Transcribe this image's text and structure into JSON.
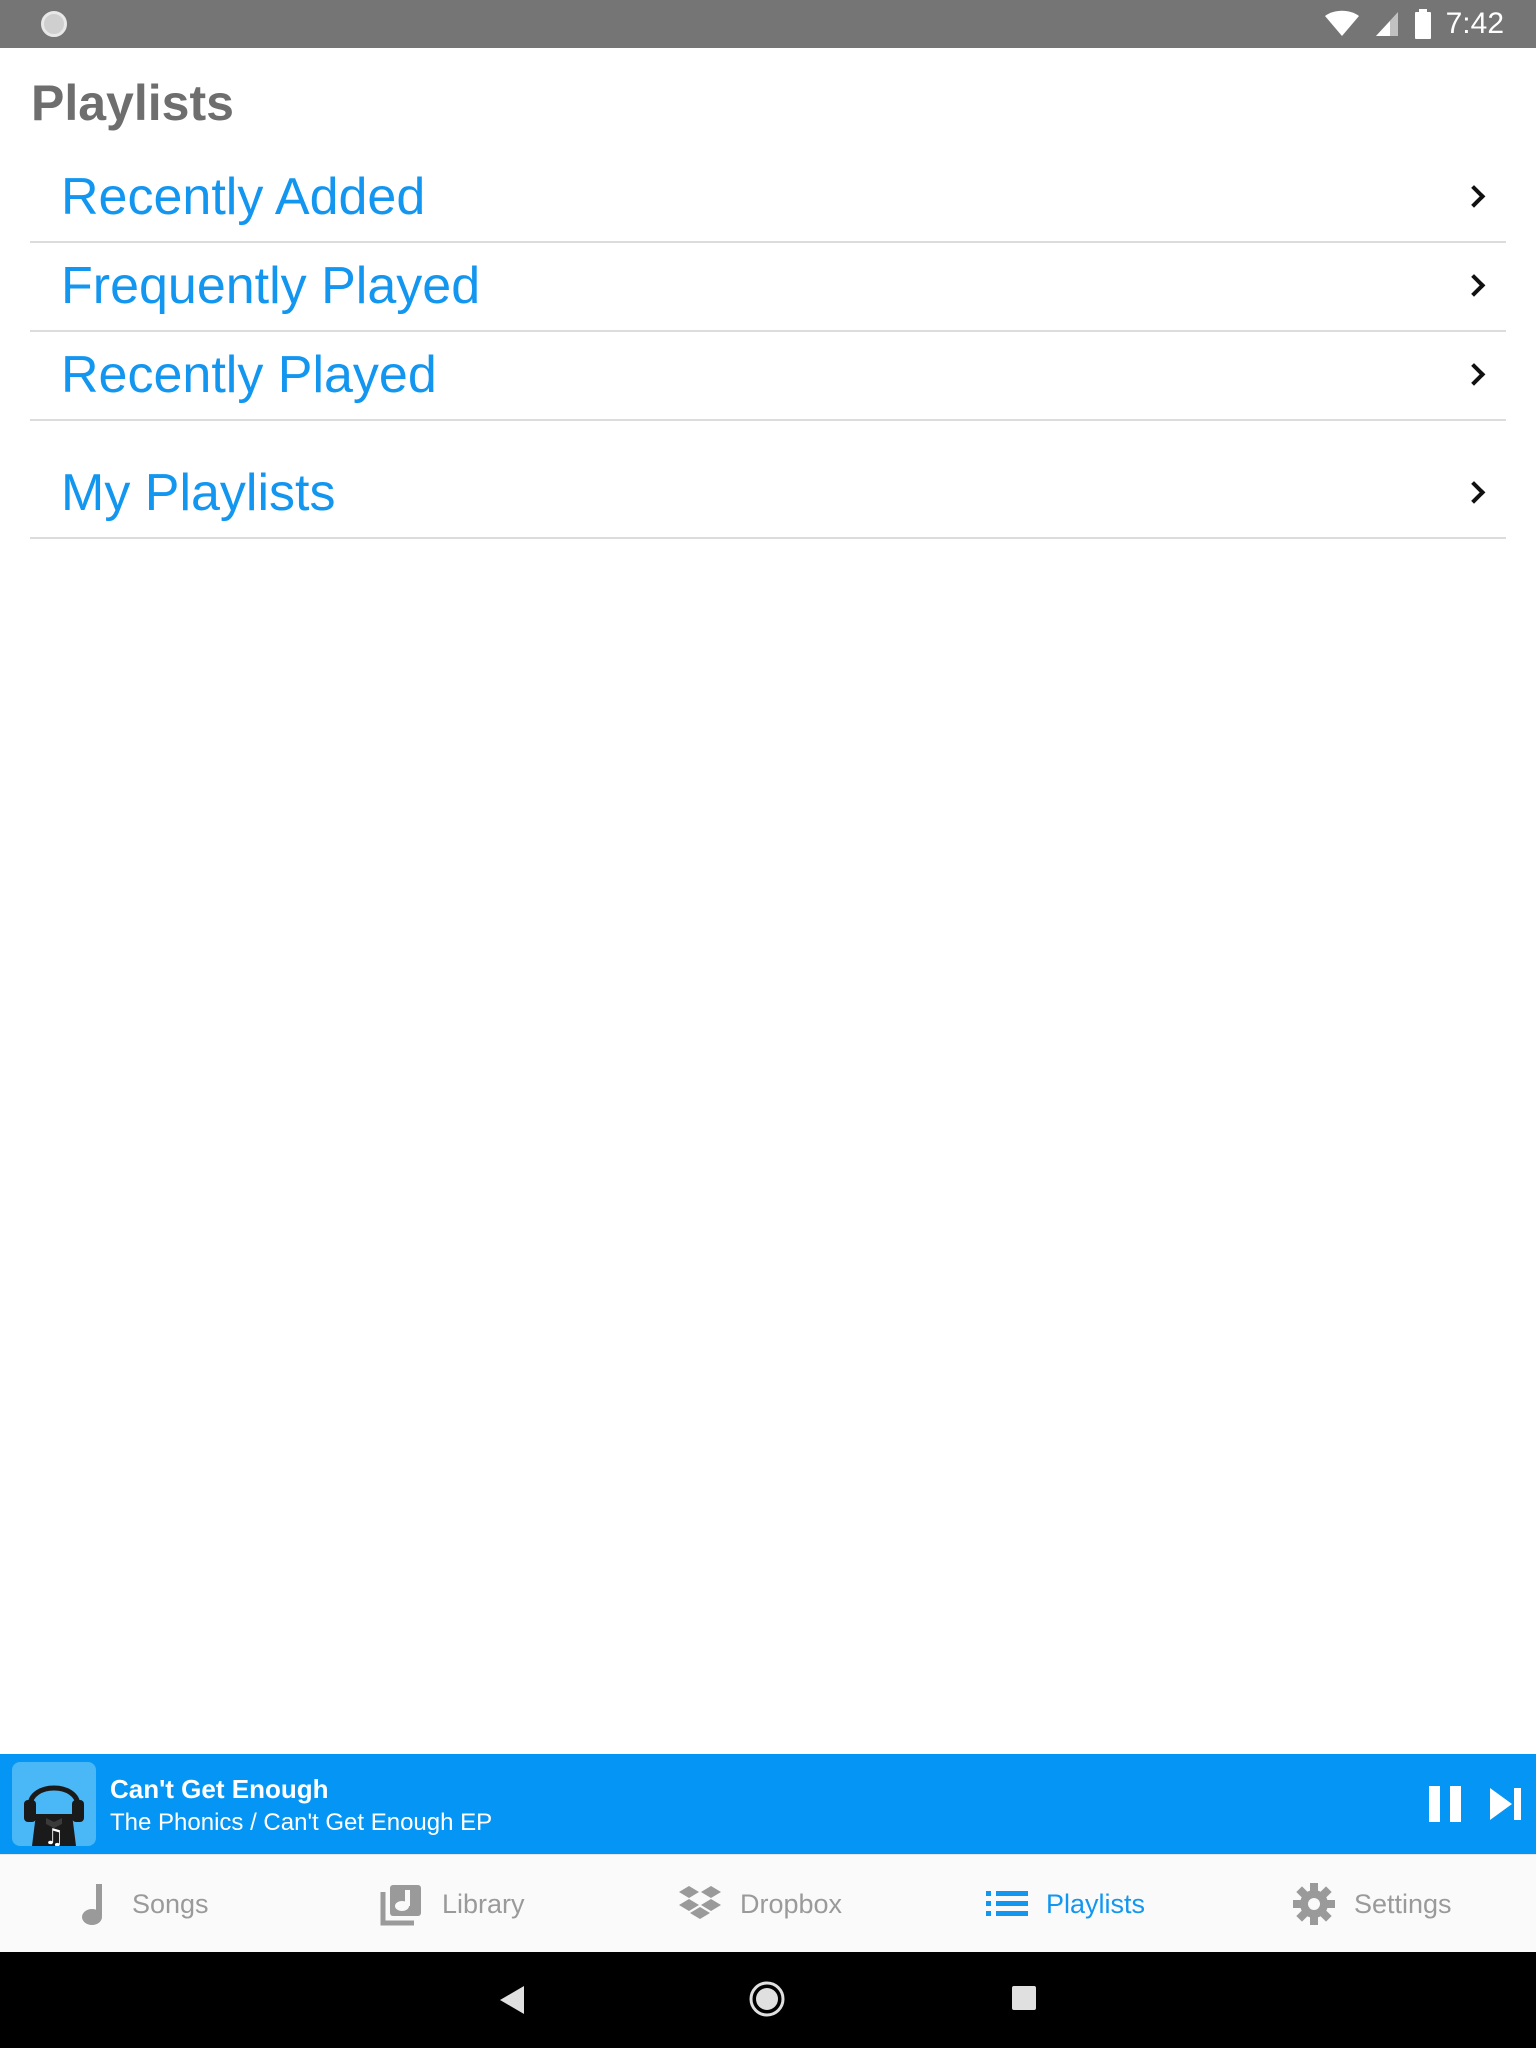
{
  "status_bar": {
    "time": "7:42",
    "icons": [
      "notification-dot-icon",
      "wifi-icon",
      "cell-signal-icon",
      "battery-icon"
    ]
  },
  "header": {
    "title": "Playlists"
  },
  "list": {
    "items": [
      {
        "label": "Recently Added"
      },
      {
        "label": "Frequently Played"
      },
      {
        "label": "Recently Played"
      },
      {
        "label": "My Playlists"
      }
    ]
  },
  "now_playing": {
    "title": "Can't Get Enough",
    "subtitle": "The Phonics / Can't Get Enough EP",
    "artwork_icon": "headphones-music-icon",
    "controls": [
      "pause-icon",
      "skip-next-icon"
    ]
  },
  "tabs": [
    {
      "label": "Songs",
      "icon": "music-note-icon",
      "active": false
    },
    {
      "label": "Library",
      "icon": "library-icon",
      "active": false
    },
    {
      "label": "Dropbox",
      "icon": "dropbox-icon",
      "active": false
    },
    {
      "label": "Playlists",
      "icon": "list-icon",
      "active": true
    },
    {
      "label": "Settings",
      "icon": "gear-icon",
      "active": false
    }
  ],
  "colors": {
    "accent": "#1296f0",
    "player_bg": "#0596f5",
    "status_bar": "#757575",
    "title_gray": "#6e6e6e",
    "inactive_tab": "#9a9a9a"
  },
  "nav_bar": {
    "buttons": [
      "back-icon",
      "home-icon",
      "recents-icon"
    ]
  }
}
